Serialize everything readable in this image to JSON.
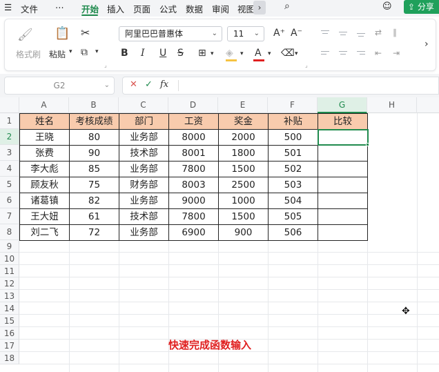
{
  "menu": {
    "file": "文件",
    "more": "⋯",
    "tabs": [
      "开始",
      "插入",
      "页面",
      "公式",
      "数据",
      "审阅",
      "视图"
    ],
    "active_tab": "开始",
    "share": "分享"
  },
  "ribbon": {
    "format_painter": "格式刷",
    "paste": "粘贴",
    "font_name": "阿里巴巴普惠体",
    "font_size": "11",
    "bold": "B",
    "italic": "I",
    "underline": "U",
    "strike": "S",
    "font_color": "#e02020",
    "fill_color": "#f6c342"
  },
  "formula_bar": {
    "name_box": "G2",
    "cancel": "✕",
    "confirm": "✓",
    "fx": "fx",
    "content": ""
  },
  "sheet": {
    "columns": [
      "A",
      "B",
      "C",
      "D",
      "E",
      "F",
      "G",
      "H"
    ],
    "rows": [
      "1",
      "2",
      "3",
      "4",
      "5",
      "6",
      "7",
      "8",
      "9",
      "10",
      "11",
      "12",
      "13",
      "14",
      "15",
      "16",
      "17",
      "18"
    ],
    "selected_cell": "G2",
    "header": [
      "姓名",
      "考核成绩",
      "部门",
      "工资",
      "奖金",
      "补贴",
      "比较"
    ],
    "data": [
      [
        "王晓",
        "80",
        "业务部",
        "8000",
        "2000",
        "500",
        ""
      ],
      [
        "张费",
        "90",
        "技术部",
        "8001",
        "1800",
        "501",
        ""
      ],
      [
        "李大彪",
        "85",
        "业务部",
        "7800",
        "1500",
        "502",
        ""
      ],
      [
        "顾友秋",
        "75",
        "财务部",
        "8003",
        "2500",
        "503",
        ""
      ],
      [
        "诸葛镇",
        "82",
        "业务部",
        "9000",
        "1000",
        "504",
        ""
      ],
      [
        "王大妞",
        "61",
        "技术部",
        "7800",
        "1500",
        "505",
        ""
      ],
      [
        "刘二飞",
        "72",
        "业务部",
        "6900",
        "900",
        "506",
        ""
      ]
    ],
    "header_fill": "#f8cbad",
    "accent": "#1f8a4d"
  },
  "caption": "快速完成函数输入"
}
